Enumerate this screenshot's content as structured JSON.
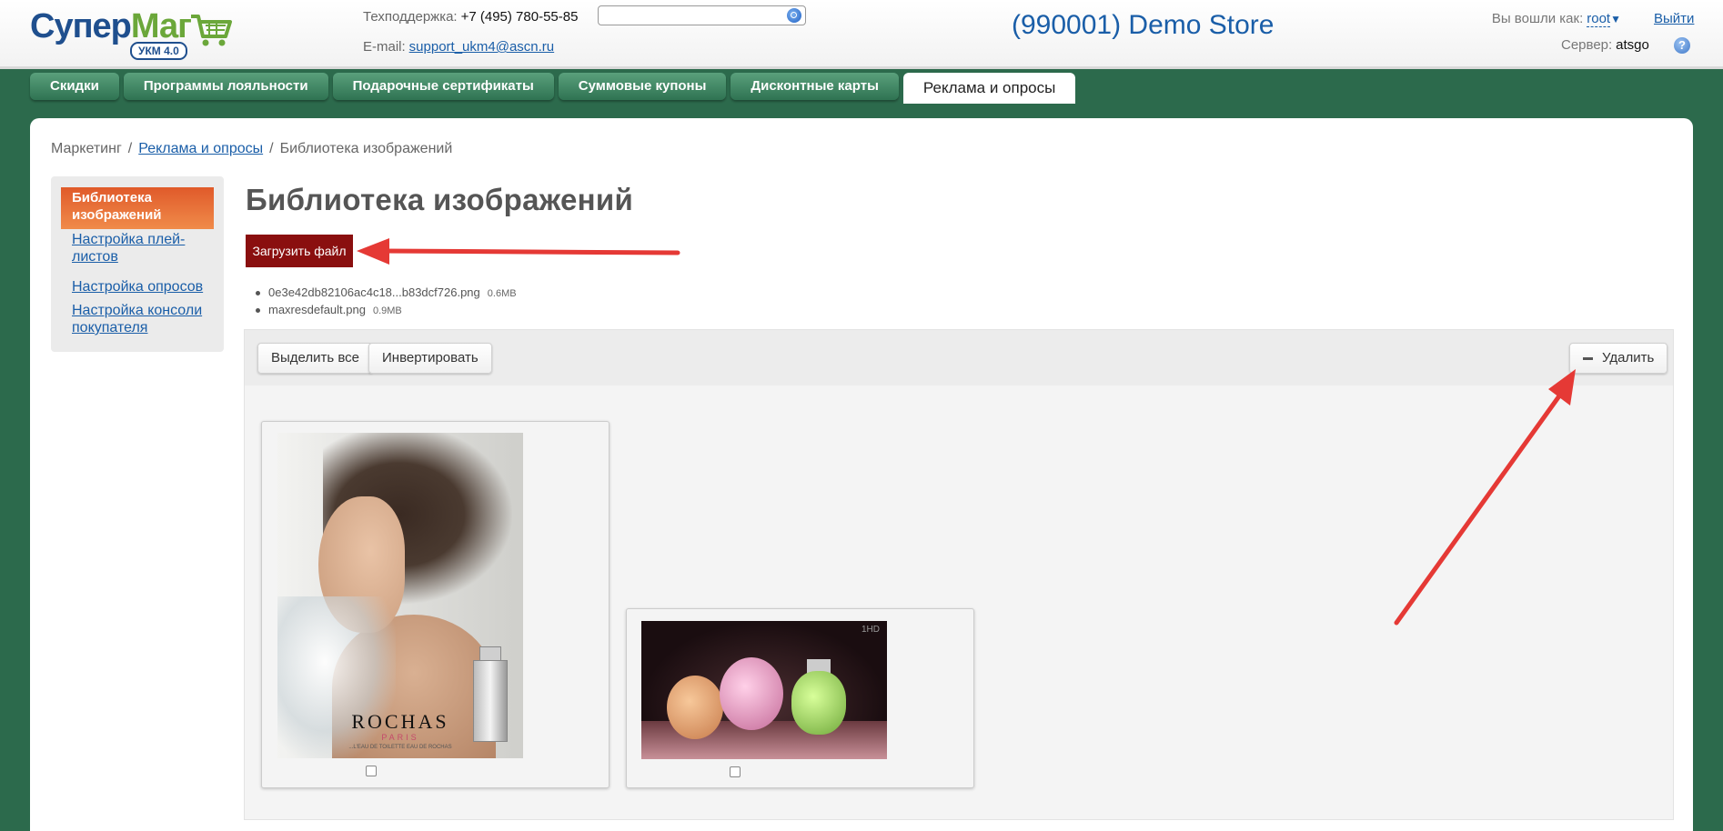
{
  "header": {
    "logo_part1": "Супер",
    "logo_part2": "Маг",
    "logo_badge": "УКМ 4.0",
    "support_label": "Техподдержка:",
    "support_phone": "+7 (495) 780-55-85",
    "email_label": "E-mail:",
    "email": "support_ukm4@ascn.ru",
    "search_value": "",
    "store_title": "(990001) Demo Store",
    "logged_label": "Вы вошли как:",
    "user": "root",
    "logout": "Выйти",
    "server_label": "Сервер:",
    "server": "atsgo",
    "help": "?"
  },
  "tabs": [
    {
      "label": "Скидки",
      "active": false
    },
    {
      "label": "Программы лояльности",
      "active": false
    },
    {
      "label": "Подарочные сертификаты",
      "active": false
    },
    {
      "label": "Суммовые купоны",
      "active": false
    },
    {
      "label": "Дисконтные карты",
      "active": false
    },
    {
      "label": "Реклама и опросы",
      "active": true
    }
  ],
  "breadcrumb": {
    "root": "Маркетинг",
    "section": "Реклама и опросы",
    "current": "Библиотека изображений",
    "sep": "/"
  },
  "sidebar": {
    "active": "Библиотека изображений",
    "items": [
      "Настройка плей-листов",
      "Настройка опросов",
      "Настройка консоли покупателя"
    ]
  },
  "main": {
    "title": "Библиотека изображений",
    "upload_label": "Загрузить файл",
    "files": [
      {
        "name": "0e3e42db82106ac4c18...b83dcf726.png",
        "size": "0.6MB"
      },
      {
        "name": "maxresdefault.png",
        "size": "0.9MB"
      }
    ],
    "toolbar": {
      "select_all": "Выделить все",
      "invert": "Инвертировать",
      "delete": "Удалить"
    },
    "image1": {
      "brand": "ROCHAS",
      "sub": "PARIS",
      "tagline": "...L'EAU DE TOILETTE EAU DE ROCHAS"
    },
    "image2": {
      "logo": "1HD"
    }
  },
  "colors": {
    "accent_green": "#2c6a4c",
    "link_blue": "#1a5ea8",
    "upload_red": "#8a0f0f",
    "sidebar_active": "#e05a2a",
    "annotation_arrow": "#e53935"
  }
}
